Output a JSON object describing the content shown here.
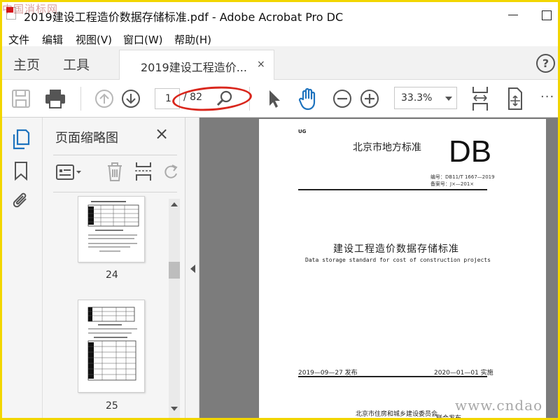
{
  "window": {
    "title": "2019建设工程造价数据存储标准.pdf - Adobe Acrobat Pro DC",
    "watermark_top": "中国消标网",
    "watermark_bottom": "www.cndao"
  },
  "menu": [
    "文件",
    "编辑",
    "视图(V)",
    "窗口(W)",
    "帮助(H)"
  ],
  "tabs": {
    "home": "主页",
    "tools": "工具",
    "document": "2019建设工程造价...",
    "close_glyph": "×"
  },
  "toolbar": {
    "current_page": "1",
    "page_total": "/ 82",
    "zoom": "33.3%",
    "more": "···"
  },
  "panel": {
    "title": "页面缩略图",
    "close_glyph": "×",
    "thumbnails": [
      {
        "label": "24"
      },
      {
        "label": "25"
      }
    ]
  },
  "document_page": {
    "corner_code": "UG",
    "standard_type": "北京市地方标准",
    "db_mark": "DB",
    "code_line1": "编号：DB11/T 1667—2019",
    "code_line2": "备案号：J×—201×",
    "title_cn": "建设工程造价数据存储标准",
    "title_en": "Data storage standard for cost of construction projects",
    "issue_date": "2019—09—27 发布",
    "implement_date": "2020—01—01 实施",
    "issuer": "北京市住房和城乡建设委员会",
    "issued": "联合发布"
  },
  "colors": {
    "accent_blue": "#1e73be",
    "annotation_red": "#d9261c",
    "frame_yellow": "#f2d600"
  }
}
